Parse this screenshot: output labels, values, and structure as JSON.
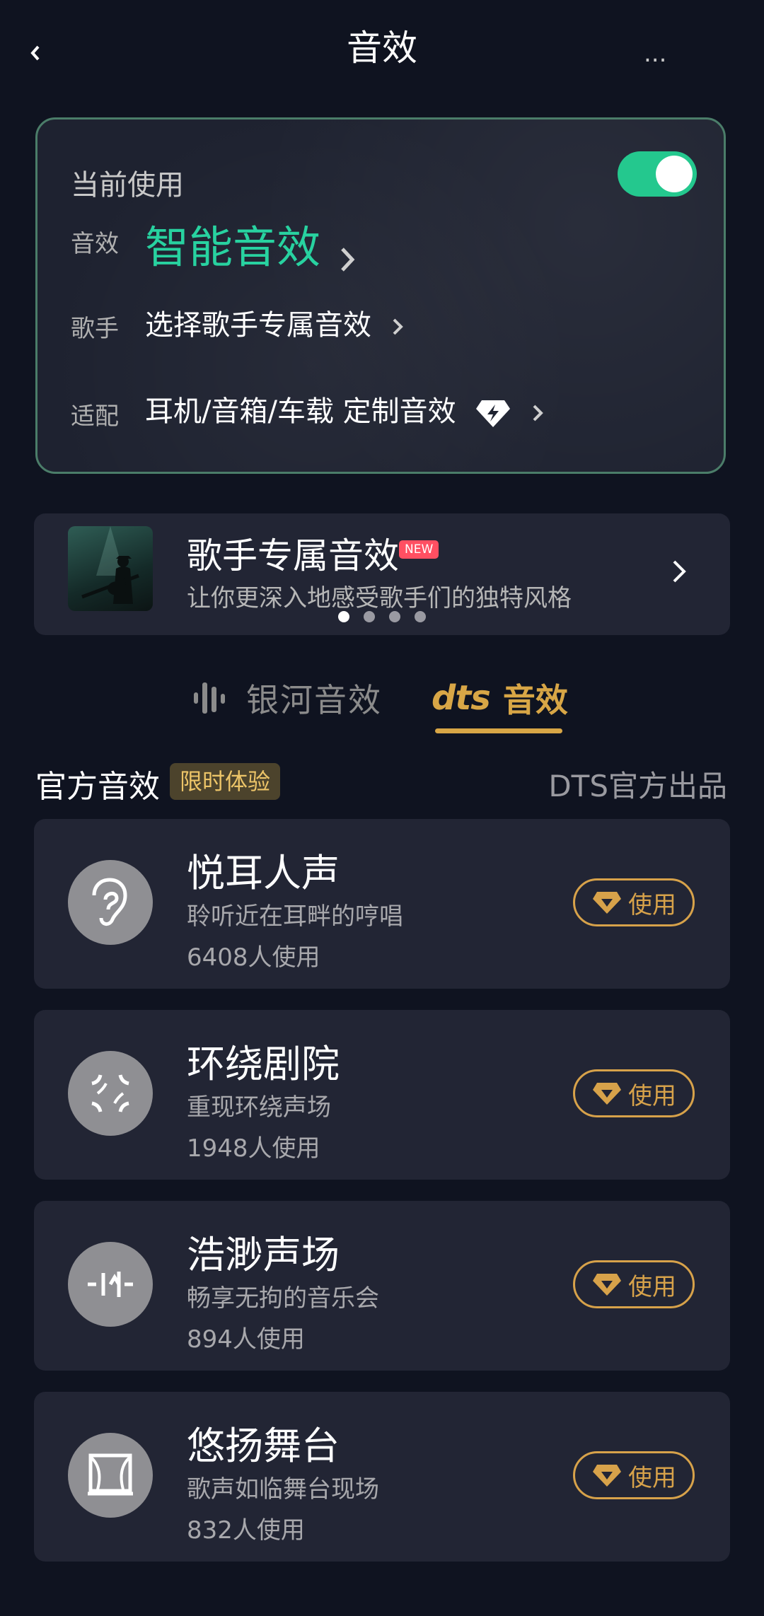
{
  "header": {
    "title": "音效",
    "back_icon": "chevron-left-icon",
    "right_text": "..."
  },
  "current": {
    "label": "当前使用",
    "enabled": true,
    "rows": {
      "effect": {
        "label": "音效",
        "value": "智能音效"
      },
      "singer": {
        "label": "歌手",
        "value": "选择歌手专属音效"
      },
      "adapt": {
        "label": "适配",
        "value": "耳机/音箱/车载 定制音效"
      }
    },
    "accent_color": "#28d2a0"
  },
  "banner": {
    "title": "歌手专属音效",
    "badge": "NEW",
    "subtitle": "让你更深入地感受歌手们的独特风格",
    "active_dot": 0,
    "dot_count": 4
  },
  "tabs": {
    "galaxy": "银河音效",
    "dts_logo": "dts",
    "dts": "音效",
    "active": "dts"
  },
  "section": {
    "title": "官方音效",
    "badge": "限时体验",
    "right": "DTS官方出品"
  },
  "effects": [
    {
      "name": "悦耳人声",
      "desc": "聆听近在耳畔的哼唱",
      "count": "6408人使用",
      "icon": "ear-icon",
      "button": "使用"
    },
    {
      "name": "环绕剧院",
      "desc": "重现环绕声场",
      "count": "1948人使用",
      "icon": "surround-icon",
      "button": "使用"
    },
    {
      "name": "浩渺声场",
      "desc": "畅享无拘的音乐会",
      "count": "894人使用",
      "icon": "soundfield-icon",
      "button": "使用"
    },
    {
      "name": "悠扬舞台",
      "desc": "歌声如临舞台现场",
      "count": "832人使用",
      "icon": "stage-icon",
      "button": "使用"
    }
  ],
  "colors": {
    "gold": "#d7a24a",
    "card": "#222534",
    "background": "#0f1320"
  }
}
